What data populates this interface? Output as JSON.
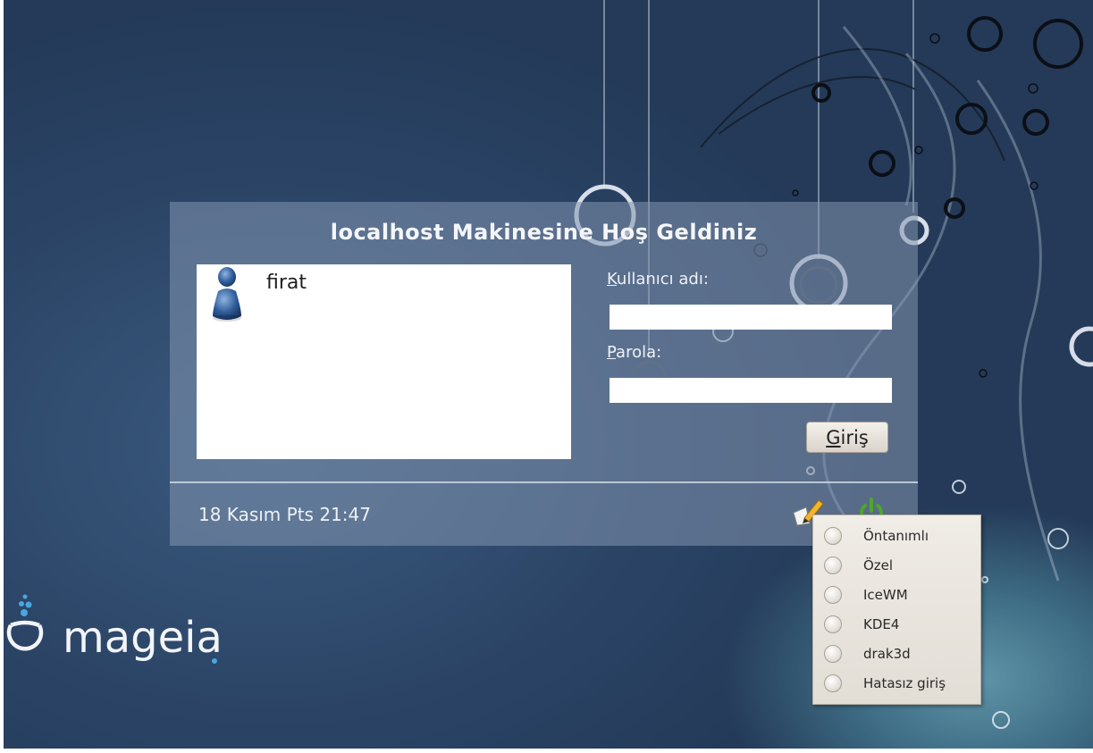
{
  "login": {
    "title": "localhost Makinesine Hoş Geldiniz",
    "users": [
      {
        "name": "firat",
        "icon": "user-icon"
      }
    ],
    "username_label_first": "K",
    "username_label_rest": "ullanıcı adı:",
    "username_value": "",
    "password_label_first": "P",
    "password_label_rest": "arola:",
    "password_value": "",
    "login_button_first": "G",
    "login_button_rest": "iriş",
    "datetime": "18 Kasım Pts 21:47"
  },
  "session_menu": {
    "items": [
      {
        "label": "Öntanımlı"
      },
      {
        "label": "Özel"
      },
      {
        "label": "IceWM"
      },
      {
        "label": "KDE4"
      },
      {
        "label": "drak3d"
      },
      {
        "label": "Hatasız giriş"
      }
    ]
  },
  "branding": {
    "logo_text": "mageia",
    "logo_icon": "mageia-logo-icon"
  },
  "colors": {
    "background": "#2a4262",
    "panel": "#8496b0",
    "power_green": "#4ea62a",
    "logo_blue": "#4aa6e0"
  }
}
